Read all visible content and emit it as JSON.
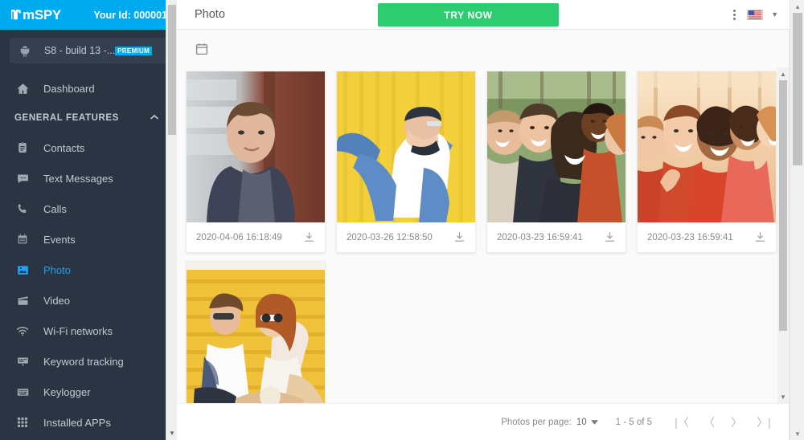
{
  "brand": {
    "logo_text": "mSPY",
    "logo_accent_color": "#00AAF0",
    "your_id_label": "Your Id: 000001"
  },
  "sidebar": {
    "device": {
      "icon": "android-icon",
      "name": "S8 - build 13 -...",
      "badge": "PREMIUM",
      "badge_color": "#00AAF0"
    },
    "dashboard": {
      "label": "Dashboard",
      "icon": "home-icon"
    },
    "section": {
      "label": "GENERAL FEATURES",
      "chevron": "chevron-up-icon"
    },
    "items": [
      {
        "label": "Contacts",
        "icon": "contacts-icon",
        "active": false
      },
      {
        "label": "Text Messages",
        "icon": "message-icon",
        "active": false
      },
      {
        "label": "Calls",
        "icon": "phone-icon",
        "active": false
      },
      {
        "label": "Events",
        "icon": "calendar-icon",
        "active": false
      },
      {
        "label": "Photo",
        "icon": "photo-icon",
        "active": true
      },
      {
        "label": "Video",
        "icon": "video-icon",
        "active": false
      },
      {
        "label": "Wi-Fi networks",
        "icon": "wifi-icon",
        "active": false
      },
      {
        "label": "Keyword tracking",
        "icon": "keyword-icon",
        "active": false
      },
      {
        "label": "Keylogger",
        "icon": "keyboard-icon",
        "active": false
      },
      {
        "label": "Installed APPs",
        "icon": "apps-grid-icon",
        "active": false
      }
    ]
  },
  "topbar": {
    "title": "Photo",
    "cta_label": "TRY NOW",
    "cta_color": "#2ecc71",
    "kebab": "more-vert-icon",
    "flag": "us-flag-icon",
    "chevron": "chevron-down-icon"
  },
  "toolbar": {
    "calendar_icon": "calendar-icon"
  },
  "photos": [
    {
      "timestamp": "2020-04-06 16:18:49",
      "alt": "portrait of young man by brick wall",
      "download_icon": "download-icon"
    },
    {
      "timestamp": "2020-03-26 12:58:50",
      "alt": "person in denim jacket on yellow background",
      "download_icon": "download-icon"
    },
    {
      "timestamp": "2020-03-23 16:59:41",
      "alt": "group selfie of friends in park",
      "download_icon": "download-icon"
    },
    {
      "timestamp": "2020-03-23 16:59:41",
      "alt": "group selfie of friends in autumn forest",
      "download_icon": "download-icon"
    },
    {
      "timestamp": "",
      "alt": "couple in sunglasses on yellow bleachers",
      "download_icon": "download-icon"
    }
  ],
  "paginator": {
    "per_page_label": "Photos per page:",
    "per_page_value": "10",
    "range_label": "1 - 5 of 5",
    "first_label": "|〈",
    "prev_label": "〈",
    "next_label": "〉",
    "last_label": "〉|"
  }
}
